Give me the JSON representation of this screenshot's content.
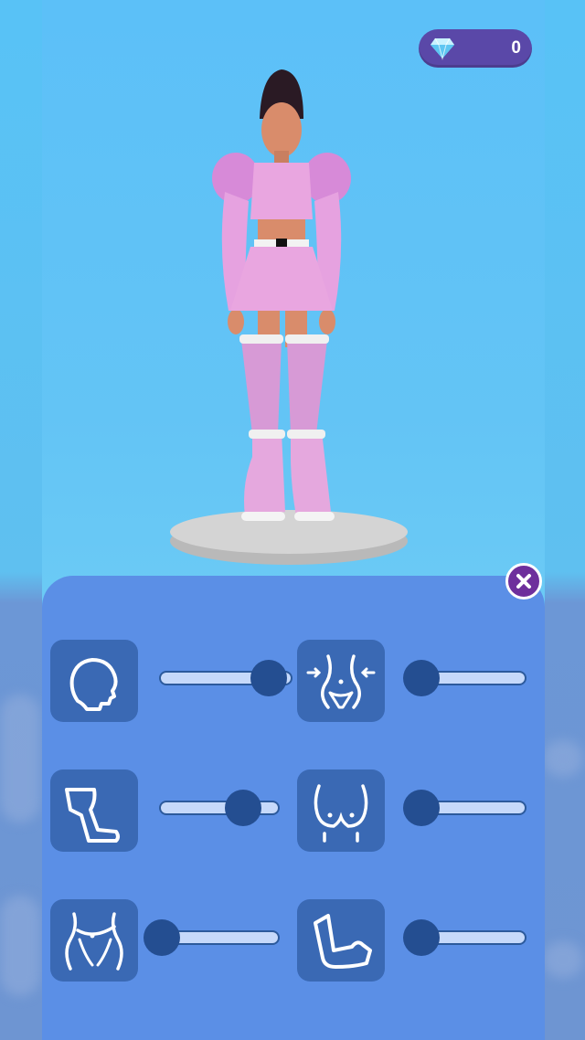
{
  "hud": {
    "gem_icon": "diamond-icon",
    "gem_count": "0"
  },
  "panel": {
    "close_icon": "close-icon",
    "controls": [
      {
        "id": "head",
        "icon": "head-icon",
        "value": 0.82
      },
      {
        "id": "waist",
        "icon": "waist-icon",
        "value": 0.13
      },
      {
        "id": "legs",
        "icon": "leg-icon",
        "value": 0.7
      },
      {
        "id": "chest",
        "icon": "chest-icon",
        "value": 0.13
      },
      {
        "id": "hips",
        "icon": "hips-icon",
        "value": 0.13
      },
      {
        "id": "arms",
        "icon": "arm-icon",
        "value": 0.13
      }
    ]
  },
  "colors": {
    "sky": "#5cc0f8",
    "panel": "#5b8fe6",
    "tile": "#3a69b4",
    "thumb": "#244e91",
    "gem_badge": "#5a48a8",
    "close_button": "#6e2f9c",
    "outfit_pink": "#e9a6e0"
  }
}
